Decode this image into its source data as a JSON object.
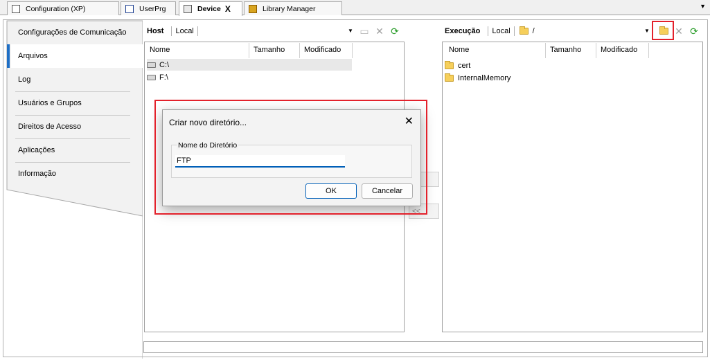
{
  "tabs": [
    {
      "label": "Configuration (XP)",
      "icon": "grid-document-icon",
      "active": false
    },
    {
      "label": "UserPrg",
      "icon": "program-icon",
      "active": false
    },
    {
      "label": "Device",
      "icon": "device-icon",
      "active": true,
      "close": "X"
    },
    {
      "label": "Library Manager",
      "icon": "library-books-icon",
      "active": false
    }
  ],
  "nav": {
    "items": [
      {
        "label": "Configurações de Comunicação"
      },
      {
        "label": "Arquivos",
        "selected": true
      },
      {
        "label": "Log"
      },
      {
        "label": "Usuários e Grupos"
      },
      {
        "label": "Direitos de Acesso"
      },
      {
        "label": "Aplicações"
      },
      {
        "label": "Informação"
      }
    ]
  },
  "host": {
    "label": "Host",
    "location": "Local",
    "columns": [
      "Nome",
      "Tamanho",
      "Modificado"
    ],
    "rows": [
      {
        "name": "C:\\",
        "icon": "drive-icon"
      },
      {
        "name": "F:\\",
        "icon": "drive-icon"
      }
    ]
  },
  "runtime": {
    "label": "Execução",
    "location": "Local",
    "path": "/",
    "columns": [
      "Nome",
      "Tamanho",
      "Modificado"
    ],
    "rows": [
      {
        "name": "cert",
        "icon": "folder-icon"
      },
      {
        "name": "InternalMemory",
        "icon": "folder-icon"
      }
    ]
  },
  "transfer": {
    "to_runtime": ">>",
    "to_host": "<<"
  },
  "dialog": {
    "title": "Criar novo diretório...",
    "close": "✕",
    "group_label": "Nome do Diretório",
    "input_value": "FTP",
    "ok_label": "OK",
    "cancel_label": "Cancelar"
  },
  "colors": {
    "highlight": "#e3212b",
    "accent": "#005fb8",
    "folder": "#f6cf5b"
  }
}
